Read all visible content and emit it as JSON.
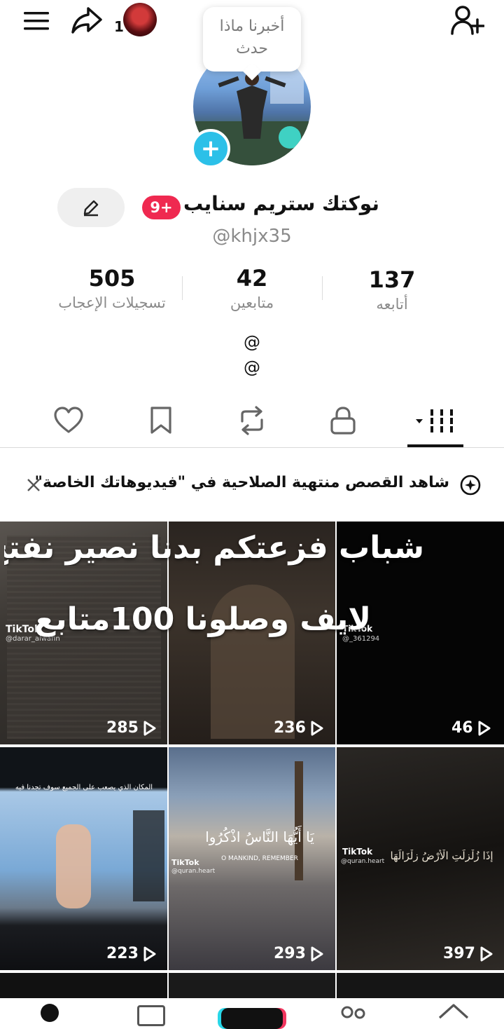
{
  "header": {
    "notification_count": "1",
    "bubble_text": "أخبرنا ماذا حدث"
  },
  "profile": {
    "name": "نوكتك ستريم سنايب",
    "badge": "9+",
    "handle": "@khjx35",
    "stats": [
      {
        "value": "505",
        "label": "تسجيلات الإعجاب"
      },
      {
        "value": "42",
        "label": "متابعين"
      },
      {
        "value": "137",
        "label": "أتابعه"
      }
    ],
    "bio_lines": [
      "@",
      "@"
    ]
  },
  "tabs": [
    {
      "name": "liked",
      "icon": "heart-icon"
    },
    {
      "name": "favorites",
      "icon": "bookmark-icon"
    },
    {
      "name": "reposts",
      "icon": "repost-icon"
    },
    {
      "name": "private",
      "icon": "lock-icon"
    },
    {
      "name": "videos",
      "icon": "grid-icon",
      "active": true
    }
  ],
  "banner": {
    "text": "شاهد القصص منتهية الصلاحية في \"فيديوهاتك الخاصة\""
  },
  "overlay_text": {
    "line1": "شباب فزعتكم بدنا نصير نفتح",
    "line2": "لايف وصلونا 100متابع"
  },
  "videos": [
    {
      "views": "285",
      "watermark": "@darar_alwafin"
    },
    {
      "views": "236",
      "watermark": ""
    },
    {
      "views": "46",
      "watermark": "@_361294"
    },
    {
      "views": "223",
      "caption": "المكان الذي يصعب على الجميع سوف تجدنا فيه"
    },
    {
      "views": "293",
      "watermark": "@quran.heart",
      "caption": "يَا أَيُّهَا النَّاسُ اذْكُرُوا",
      "subcaption": "O MANKIND, REMEMBER"
    },
    {
      "views": "397",
      "watermark": "@quran.heart",
      "caption": "إِذَا زُلْزِلَتِ الْأَرْضُ زِلْزَالَهَا"
    }
  ],
  "tiktok_label": "TikTok"
}
